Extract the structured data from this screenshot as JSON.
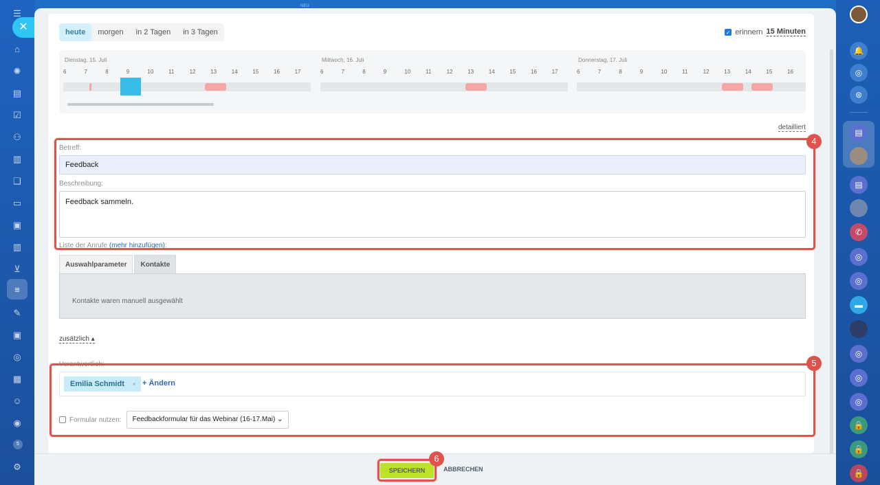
{
  "top_hint": "NEU",
  "left_sidebar": {
    "close_label": "✕",
    "badge": "5",
    "icons": [
      "menu-icon",
      "home-icon",
      "stream-icon",
      "document-icon",
      "tasks-icon",
      "contacts-icon",
      "file-icon",
      "chat-icon",
      "card-icon",
      "presentation-icon",
      "chart-icon",
      "cart-icon",
      "filter-icon",
      "edit-icon",
      "id-card-icon",
      "target-icon",
      "calendar-grid-icon",
      "robot-icon",
      "goal-icon",
      "settings-icon"
    ]
  },
  "day_tabs": [
    "heute",
    "morgen",
    "in 2 Tagen",
    "in 3 Tagen"
  ],
  "remind": {
    "label": "erinnern",
    "value": "15 Minuten",
    "checked": true
  },
  "timeline": {
    "days": [
      {
        "label": "Dienstag, 15. Juli",
        "hours": [
          "6",
          "7",
          "8",
          "9",
          "10",
          "11",
          "12",
          "13",
          "14",
          "15",
          "16",
          "17"
        ]
      },
      {
        "label": "Mittwoch, 16. Juli",
        "hours": [
          "6",
          "7",
          "8",
          "9",
          "10",
          "11",
          "12",
          "13",
          "14",
          "15",
          "16",
          "17"
        ]
      },
      {
        "label": "Donnerstag, 17. Juli",
        "hours": [
          "6",
          "7",
          "8",
          "9",
          "10",
          "11",
          "12",
          "13",
          "14",
          "15",
          "16"
        ]
      }
    ]
  },
  "detail_link": "detailliert",
  "subject": {
    "label": "Betreff:",
    "value": "Feedback"
  },
  "description": {
    "label": "Beschreibung:",
    "value": "Feedback sammeln."
  },
  "calls": {
    "label": "Liste der Anrufe",
    "link": "(mehr hinzufügen)",
    "suffix": ":"
  },
  "tabs": [
    "Auswahlparameter",
    "Kontakte"
  ],
  "tab_content": "Kontakte waren manuell ausgewählt",
  "extra_link": "zusätzlich ▴",
  "responsible": {
    "label": "Verantwortlich:",
    "name": "Emilia Schmidt",
    "remove": "×",
    "change": "+ Ändern"
  },
  "form": {
    "label": "Formular nutzen:",
    "selected": "Feedbackformular für das Webinar (16-17.Mai)",
    "checked": false
  },
  "highlights": [
    "4",
    "5",
    "6"
  ],
  "footer": {
    "save": "SPEICHERN",
    "cancel": "ABBRECHEN"
  },
  "colors": {
    "accent": "#e0524c",
    "save": "#bde326",
    "selected_day": "#d4f1fb",
    "busy": "#f7a6a6",
    "selection": "#38bde8"
  }
}
